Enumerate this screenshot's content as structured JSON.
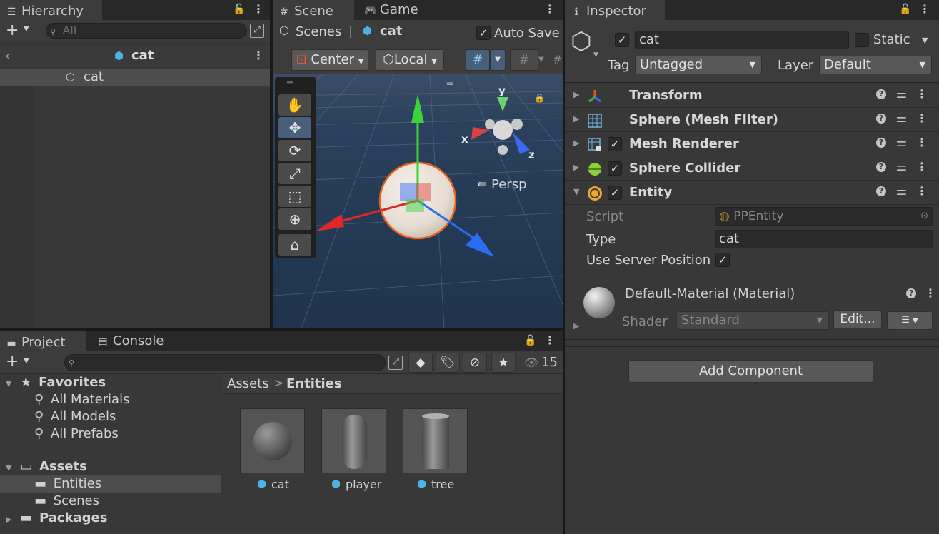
{
  "hierarchy": {
    "tab": "Hierarchy",
    "search_placeholder": "All",
    "scene_title": "cat",
    "items": [
      {
        "label": "cat"
      }
    ]
  },
  "scene_view": {
    "tabs": [
      {
        "label": "Scene"
      },
      {
        "label": "Game"
      }
    ],
    "breadcrumb_root": "Scenes",
    "breadcrumb_sep": "|",
    "breadcrumb_current": "cat",
    "auto_save_label": "Auto Save",
    "auto_save_checked": true,
    "pivot_mode": "Center",
    "pivot_rotation": "Local",
    "persp_label": "Persp",
    "gizmo_axes": {
      "x": "x",
      "y": "y",
      "z": "z"
    },
    "tools": [
      "hand-tool",
      "move-tool",
      "rotate-tool",
      "scale-tool",
      "rect-tool",
      "transform-tool",
      "custom-tool"
    ]
  },
  "inspector": {
    "tab": "Inspector",
    "object_name": "cat",
    "active_checked": true,
    "static_label": "Static",
    "tag_label": "Tag",
    "tag_value": "Untagged",
    "layer_label": "Layer",
    "layer_value": "Default",
    "components": [
      {
        "name": "Transform"
      },
      {
        "name": "Sphere (Mesh Filter)"
      },
      {
        "name": "Mesh Renderer"
      },
      {
        "name": "Sphere Collider"
      },
      {
        "name": "Entity"
      }
    ],
    "entity": {
      "script_label": "Script",
      "script_value": "PPEntity",
      "type_label": "Type",
      "type_value": "cat",
      "server_pos_label": "Use Server Position"
    },
    "material": {
      "name": "Default-Material (Material)",
      "shader_label": "Shader",
      "shader_value": "Standard",
      "edit_label": "Edit..."
    },
    "add_component_label": "Add Component"
  },
  "project": {
    "tabs": [
      {
        "label": "Project"
      },
      {
        "label": "Console"
      }
    ],
    "hidden_count": "15",
    "favorites_label": "Favorites",
    "favorites": [
      {
        "label": "All Materials"
      },
      {
        "label": "All Models"
      },
      {
        "label": "All Prefabs"
      }
    ],
    "assets_label": "Assets",
    "asset_folders": [
      {
        "label": "Entities"
      },
      {
        "label": "Scenes"
      }
    ],
    "packages_label": "Packages",
    "breadcrumb_root": "Assets",
    "breadcrumb_sep": ">",
    "breadcrumb_current": "Entities",
    "assets": [
      {
        "label": "cat"
      },
      {
        "label": "player"
      },
      {
        "label": "tree"
      }
    ]
  },
  "colors": {
    "panel_bg": "#383838",
    "tab_bg": "#282828",
    "selection": "#4d4d4d",
    "accent_blue": "#4ab4e6",
    "scene_sky": "#24374f"
  }
}
